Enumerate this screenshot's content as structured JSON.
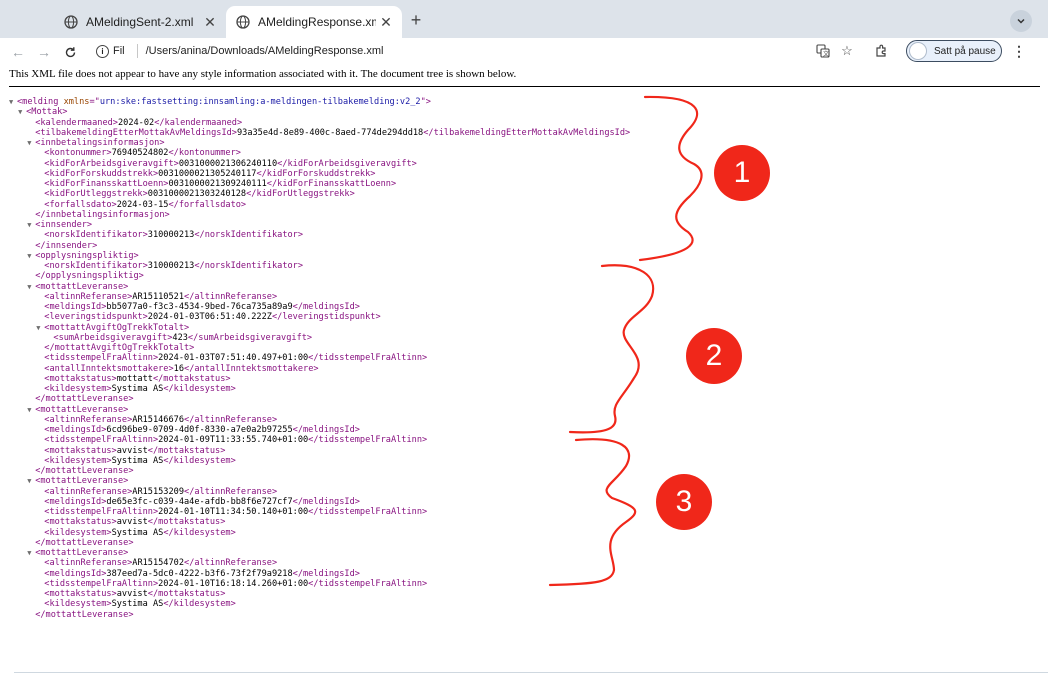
{
  "tabs": [
    {
      "title": "AMeldingSent-2.xml",
      "active": false
    },
    {
      "title": "AMeldingResponse.xml",
      "active": true
    }
  ],
  "toolbar": {
    "site_chip": "Fil",
    "url": "/Users/anina/Downloads/AMeldingResponse.xml",
    "profile_label": "Satt på pause"
  },
  "info_line": "This XML file does not appear to have any style information associated with it. The document tree is shown below.",
  "xml_lines": [
    {
      "indent": 0,
      "tri": "▼",
      "parts": [
        [
          "t",
          "<melding "
        ],
        [
          "a",
          "xmlns"
        ],
        [
          "t",
          "=\""
        ],
        [
          "v",
          "urn:ske:fastsetting:innsamling:a-meldingen-tilbakemelding:v2_2"
        ],
        [
          "t",
          "\">"
        ]
      ]
    },
    {
      "indent": 1,
      "tri": "▼",
      "parts": [
        [
          "t",
          "<Mottak>"
        ]
      ]
    },
    {
      "indent": 2,
      "tri": "",
      "parts": [
        [
          "t",
          "<kalendermaaned>"
        ],
        [
          "x",
          "2024-02"
        ],
        [
          "t",
          "</kalendermaaned>"
        ]
      ]
    },
    {
      "indent": 2,
      "tri": "",
      "parts": [
        [
          "t",
          "<tilbakemeldingEtterMottakAvMeldingsId>"
        ],
        [
          "x",
          "93a35e4d-8e89-400c-8aed-774de294dd18"
        ],
        [
          "t",
          "</tilbakemeldingEtterMottakAvMeldingsId>"
        ]
      ]
    },
    {
      "indent": 2,
      "tri": "▼",
      "parts": [
        [
          "t",
          "<innbetalingsinformasjon>"
        ]
      ]
    },
    {
      "indent": 3,
      "tri": "",
      "parts": [
        [
          "t",
          "<kontonummer>"
        ],
        [
          "x",
          "76940524802"
        ],
        [
          "t",
          "</kontonummer>"
        ]
      ]
    },
    {
      "indent": 3,
      "tri": "",
      "parts": [
        [
          "t",
          "<kidForArbeidsgiveravgift>"
        ],
        [
          "x",
          "0031000021306240110"
        ],
        [
          "t",
          "</kidForArbeidsgiveravgift>"
        ]
      ]
    },
    {
      "indent": 3,
      "tri": "",
      "parts": [
        [
          "t",
          "<kidForForskuddstrekk>"
        ],
        [
          "x",
          "0031000021305240117"
        ],
        [
          "t",
          "</kidForForskuddstrekk>"
        ]
      ]
    },
    {
      "indent": 3,
      "tri": "",
      "parts": [
        [
          "t",
          "<kidForFinansskattLoenn>"
        ],
        [
          "x",
          "0031000021309240111"
        ],
        [
          "t",
          "</kidForFinansskattLoenn>"
        ]
      ]
    },
    {
      "indent": 3,
      "tri": "",
      "parts": [
        [
          "t",
          "<kidForUtleggstrekk>"
        ],
        [
          "x",
          "0031000021303240128"
        ],
        [
          "t",
          "</kidForUtleggstrekk>"
        ]
      ]
    },
    {
      "indent": 3,
      "tri": "",
      "parts": [
        [
          "t",
          "<forfallsdato>"
        ],
        [
          "x",
          "2024-03-15"
        ],
        [
          "t",
          "</forfallsdato>"
        ]
      ]
    },
    {
      "indent": 2,
      "tri": "",
      "parts": [
        [
          "t",
          "</innbetalingsinformasjon>"
        ]
      ]
    },
    {
      "indent": 2,
      "tri": "▼",
      "parts": [
        [
          "t",
          "<innsender>"
        ]
      ]
    },
    {
      "indent": 3,
      "tri": "",
      "parts": [
        [
          "t",
          "<norskIdentifikator>"
        ],
        [
          "x",
          "310000213"
        ],
        [
          "t",
          "</norskIdentifikator>"
        ]
      ]
    },
    {
      "indent": 2,
      "tri": "",
      "parts": [
        [
          "t",
          "</innsender>"
        ]
      ]
    },
    {
      "indent": 2,
      "tri": "▼",
      "parts": [
        [
          "t",
          "<opplysningspliktig>"
        ]
      ]
    },
    {
      "indent": 3,
      "tri": "",
      "parts": [
        [
          "t",
          "<norskIdentifikator>"
        ],
        [
          "x",
          "310000213"
        ],
        [
          "t",
          "</norskIdentifikator>"
        ]
      ]
    },
    {
      "indent": 2,
      "tri": "",
      "parts": [
        [
          "t",
          "</opplysningspliktig>"
        ]
      ]
    },
    {
      "indent": 2,
      "tri": "▼",
      "parts": [
        [
          "t",
          "<mottattLeveranse>"
        ]
      ]
    },
    {
      "indent": 3,
      "tri": "",
      "parts": [
        [
          "t",
          "<altinnReferanse>"
        ],
        [
          "x",
          "AR15110521"
        ],
        [
          "t",
          "</altinnReferanse>"
        ]
      ]
    },
    {
      "indent": 3,
      "tri": "",
      "parts": [
        [
          "t",
          "<meldingsId>"
        ],
        [
          "x",
          "bb5077a0-f3c3-4534-9bed-76ca735a89a9"
        ],
        [
          "t",
          "</meldingsId>"
        ]
      ]
    },
    {
      "indent": 3,
      "tri": "",
      "parts": [
        [
          "t",
          "<leveringstidspunkt>"
        ],
        [
          "x",
          "2024-01-03T06:51:40.222Z"
        ],
        [
          "t",
          "</leveringstidspunkt>"
        ]
      ]
    },
    {
      "indent": 3,
      "tri": "▼",
      "parts": [
        [
          "t",
          "<mottattAvgiftOgTrekkTotalt>"
        ]
      ]
    },
    {
      "indent": 4,
      "tri": "",
      "parts": [
        [
          "t",
          "<sumArbeidsgiveravgift>"
        ],
        [
          "x",
          "423"
        ],
        [
          "t",
          "</sumArbeidsgiveravgift>"
        ]
      ]
    },
    {
      "indent": 3,
      "tri": "",
      "parts": [
        [
          "t",
          "</mottattAvgiftOgTrekkTotalt>"
        ]
      ]
    },
    {
      "indent": 3,
      "tri": "",
      "parts": [
        [
          "t",
          "<tidsstempelFraAltinn>"
        ],
        [
          "x",
          "2024-01-03T07:51:40.497+01:00"
        ],
        [
          "t",
          "</tidsstempelFraAltinn>"
        ]
      ]
    },
    {
      "indent": 3,
      "tri": "",
      "parts": [
        [
          "t",
          "<antallInntektsmottakere>"
        ],
        [
          "x",
          "16"
        ],
        [
          "t",
          "</antallInntektsmottakere>"
        ]
      ]
    },
    {
      "indent": 3,
      "tri": "",
      "parts": [
        [
          "t",
          "<mottakstatus>"
        ],
        [
          "x",
          "mottatt"
        ],
        [
          "t",
          "</mottakstatus>"
        ]
      ]
    },
    {
      "indent": 3,
      "tri": "",
      "parts": [
        [
          "t",
          "<kildesystem>"
        ],
        [
          "x",
          "Systima AS"
        ],
        [
          "t",
          "</kildesystem>"
        ]
      ]
    },
    {
      "indent": 2,
      "tri": "",
      "parts": [
        [
          "t",
          "</mottattLeveranse>"
        ]
      ]
    },
    {
      "indent": 2,
      "tri": "▼",
      "parts": [
        [
          "t",
          "<mottattLeveranse>"
        ]
      ]
    },
    {
      "indent": 3,
      "tri": "",
      "parts": [
        [
          "t",
          "<altinnReferanse>"
        ],
        [
          "x",
          "AR15146676"
        ],
        [
          "t",
          "</altinnReferanse>"
        ]
      ]
    },
    {
      "indent": 3,
      "tri": "",
      "parts": [
        [
          "t",
          "<meldingsId>"
        ],
        [
          "x",
          "6cd96be9-0709-4d0f-8330-a7e0a2b97255"
        ],
        [
          "t",
          "</meldingsId>"
        ]
      ]
    },
    {
      "indent": 3,
      "tri": "",
      "parts": [
        [
          "t",
          "<tidsstempelFraAltinn>"
        ],
        [
          "x",
          "2024-01-09T11:33:55.740+01:00"
        ],
        [
          "t",
          "</tidsstempelFraAltinn>"
        ]
      ]
    },
    {
      "indent": 3,
      "tri": "",
      "parts": [
        [
          "t",
          "<mottakstatus>"
        ],
        [
          "x",
          "avvist"
        ],
        [
          "t",
          "</mottakstatus>"
        ]
      ]
    },
    {
      "indent": 3,
      "tri": "",
      "parts": [
        [
          "t",
          "<kildesystem>"
        ],
        [
          "x",
          "Systima AS"
        ],
        [
          "t",
          "</kildesystem>"
        ]
      ]
    },
    {
      "indent": 2,
      "tri": "",
      "parts": [
        [
          "t",
          "</mottattLeveranse>"
        ]
      ]
    },
    {
      "indent": 2,
      "tri": "▼",
      "parts": [
        [
          "t",
          "<mottattLeveranse>"
        ]
      ]
    },
    {
      "indent": 3,
      "tri": "",
      "parts": [
        [
          "t",
          "<altinnReferanse>"
        ],
        [
          "x",
          "AR15153209"
        ],
        [
          "t",
          "</altinnReferanse>"
        ]
      ]
    },
    {
      "indent": 3,
      "tri": "",
      "parts": [
        [
          "t",
          "<meldingsId>"
        ],
        [
          "x",
          "de65e3fc-c039-4a4e-afdb-bb8f6e727cf7"
        ],
        [
          "t",
          "</meldingsId>"
        ]
      ]
    },
    {
      "indent": 3,
      "tri": "",
      "parts": [
        [
          "t",
          "<tidsstempelFraAltinn>"
        ],
        [
          "x",
          "2024-01-10T11:34:50.140+01:00"
        ],
        [
          "t",
          "</tidsstempelFraAltinn>"
        ]
      ]
    },
    {
      "indent": 3,
      "tri": "",
      "parts": [
        [
          "t",
          "<mottakstatus>"
        ],
        [
          "x",
          "avvist"
        ],
        [
          "t",
          "</mottakstatus>"
        ]
      ]
    },
    {
      "indent": 3,
      "tri": "",
      "parts": [
        [
          "t",
          "<kildesystem>"
        ],
        [
          "x",
          "Systima AS"
        ],
        [
          "t",
          "</kildesystem>"
        ]
      ]
    },
    {
      "indent": 2,
      "tri": "",
      "parts": [
        [
          "t",
          "</mottattLeveranse>"
        ]
      ]
    },
    {
      "indent": 2,
      "tri": "▼",
      "parts": [
        [
          "t",
          "<mottattLeveranse>"
        ]
      ]
    },
    {
      "indent": 3,
      "tri": "",
      "parts": [
        [
          "t",
          "<altinnReferanse>"
        ],
        [
          "x",
          "AR15154702"
        ],
        [
          "t",
          "</altinnReferanse>"
        ]
      ]
    },
    {
      "indent": 3,
      "tri": "",
      "parts": [
        [
          "t",
          "<meldingsId>"
        ],
        [
          "x",
          "387eed7a-5dc0-4222-b3f6-73f2f79a9218"
        ],
        [
          "t",
          "</meldingsId>"
        ]
      ]
    },
    {
      "indent": 3,
      "tri": "",
      "parts": [
        [
          "t",
          "<tidsstempelFraAltinn>"
        ],
        [
          "x",
          "2024-01-10T16:18:14.260+01:00"
        ],
        [
          "t",
          "</tidsstempelFraAltinn>"
        ]
      ]
    },
    {
      "indent": 3,
      "tri": "",
      "parts": [
        [
          "t",
          "<mottakstatus>"
        ],
        [
          "x",
          "avvist"
        ],
        [
          "t",
          "</mottakstatus>"
        ]
      ]
    },
    {
      "indent": 3,
      "tri": "",
      "parts": [
        [
          "t",
          "<kildesystem>"
        ],
        [
          "x",
          "Systima AS"
        ],
        [
          "t",
          "</kildesystem>"
        ]
      ]
    },
    {
      "indent": 2,
      "tri": "",
      "parts": [
        [
          "t",
          "</mottattLeveranse>"
        ]
      ]
    }
  ],
  "annotations": [
    "1",
    "2",
    "3"
  ],
  "colors": {
    "annotation": "#f0271a",
    "tag": "#881280",
    "attr_name": "#994500",
    "attr_value": "#1a1aa6"
  }
}
